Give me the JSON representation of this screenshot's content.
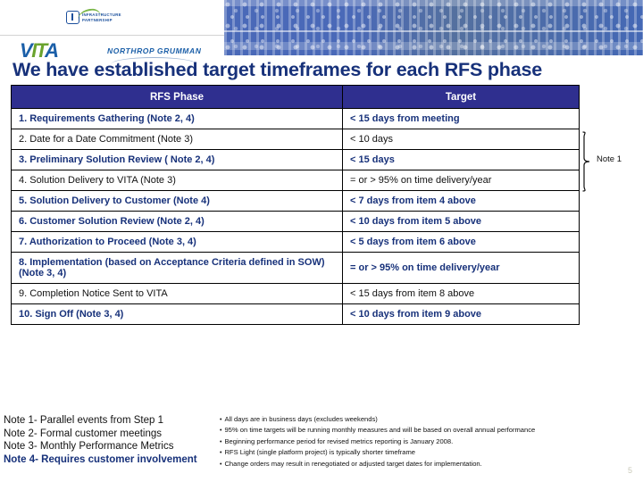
{
  "branding": {
    "infrastructure_partnership_line1": "INFRASTRUCTURE",
    "infrastructure_partnership_line2": "PARTNERSHIP",
    "vita_v": "V",
    "vita_it": "IT",
    "vita_a": "A",
    "northrop_grumman": "NORTHROP GRUMMAN"
  },
  "title": "We have established target timeframes for each RFS phase",
  "table": {
    "headers": [
      "RFS Phase",
      "Target"
    ],
    "rows": [
      {
        "phase": "1. Requirements Gathering (Note 2, 4)",
        "target": "< 15 days from meeting",
        "style": "bold"
      },
      {
        "phase": "2. Date for a Date Commitment (Note 3)",
        "target": "< 10 days",
        "style": "plain"
      },
      {
        "phase": "3. Preliminary Solution Review ( Note 2, 4)",
        "target": "< 15 days",
        "style": "bold"
      },
      {
        "phase": "4. Solution Delivery to VITA (Note 3)",
        "target": "= or > 95% on time delivery/year",
        "style": "plain"
      },
      {
        "phase": "5. Solution  Delivery to Customer (Note 4)",
        "target": "< 7 days from item 4 above",
        "style": "bold"
      },
      {
        "phase": "6. Customer Solution Review (Note 2, 4)",
        "target": "< 10 days from item 5 above",
        "style": "bold"
      },
      {
        "phase": "7. Authorization to Proceed (Note 3, 4)",
        "target": "< 5 days from item 6 above",
        "style": "bold"
      },
      {
        "phase": "8. Implementation (based on Acceptance Criteria defined in SOW) (Note 3, 4)",
        "target": "= or > 95%  on time delivery/year",
        "style": "bold"
      },
      {
        "phase": "9. Completion Notice Sent to VITA",
        "target": "< 15 days from item 8 above",
        "style": "plain"
      },
      {
        "phase": "10. Sign Off (Note 3, 4)",
        "target": "< 10 days from item 9 above",
        "style": "bold"
      }
    ]
  },
  "callout": {
    "note1_label": "Note 1"
  },
  "notes": [
    {
      "text": "Note 1- Parallel events from Step 1",
      "style": "plain"
    },
    {
      "text": "Note 2- Formal customer meetings",
      "style": "plain"
    },
    {
      "text": "Note 3- Monthly Performance Metrics",
      "style": "plain"
    },
    {
      "text": "Note 4- Requires customer involvement",
      "style": "bold"
    }
  ],
  "bullets": [
    "All days are in business days (excludes weekends)",
    "95% on time targets will be running monthly measures and will be based on overall annual performance",
    "Beginning performance period for revised metrics reporting is January 2008.",
    "RFS Light (single platform project) is typically shorter timeframe",
    "Change orders may result in renegotiated or adjusted target dates for implementation."
  ],
  "slide_number": "5",
  "colors": {
    "header_navy": "#2f2f8f",
    "title_navy": "#17317a",
    "banner_blue": "#4a69b8",
    "vita_green": "#6aa32e"
  }
}
